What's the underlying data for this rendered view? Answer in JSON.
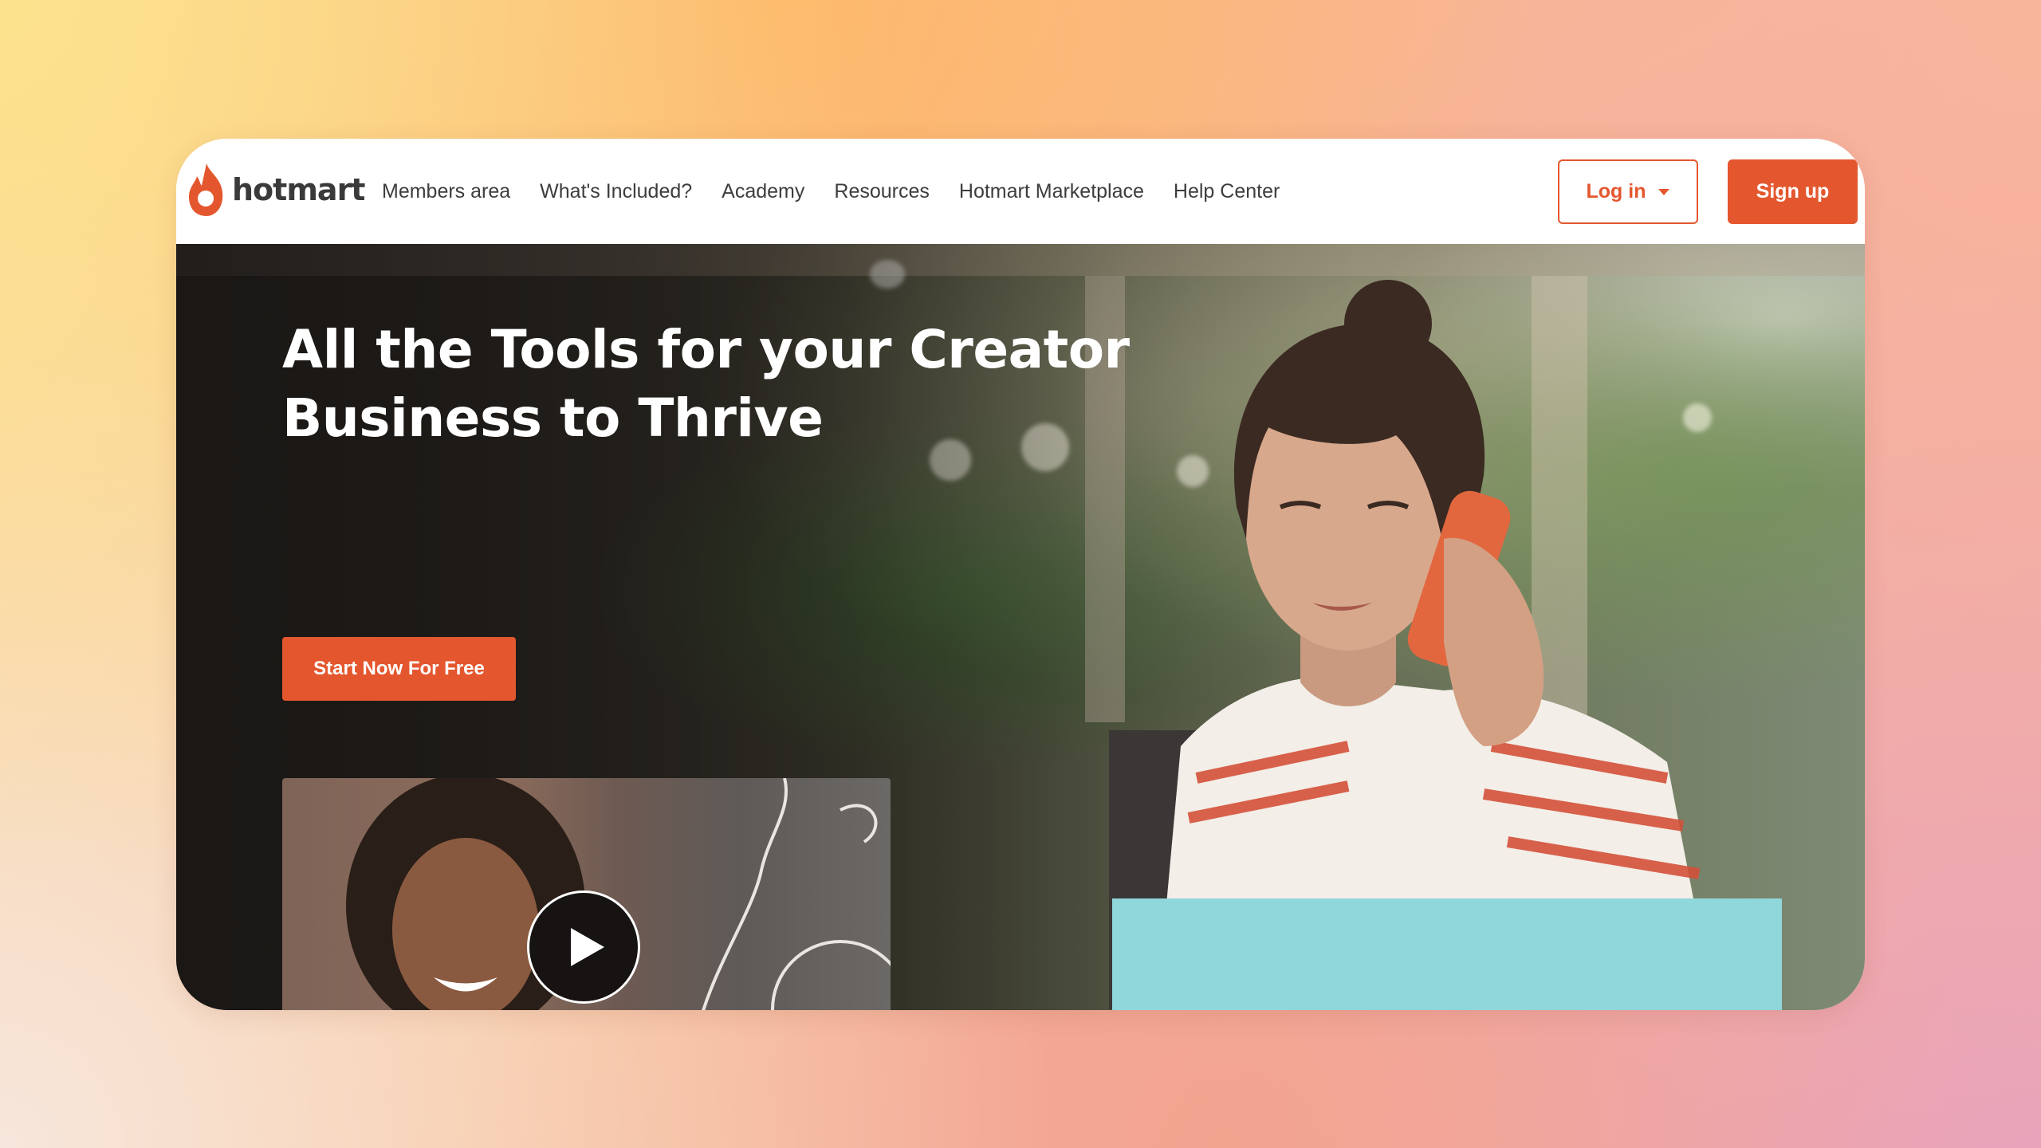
{
  "brand": {
    "name": "hotmart",
    "accent_color": "#e4572e",
    "logo_icon": "flame-icon"
  },
  "nav": {
    "items": [
      {
        "label": "Members area"
      },
      {
        "label": "What's Included?"
      },
      {
        "label": "Academy"
      },
      {
        "label": "Resources"
      },
      {
        "label": "Hotmart Marketplace"
      },
      {
        "label": "Help Center"
      }
    ],
    "login_label": "Log in",
    "login_icon": "caret-down-icon",
    "signup_label": "Sign up"
  },
  "hero": {
    "headline_line1": "All the Tools for your Creator",
    "headline_line2": "Business to Thrive",
    "cta_label": "Start Now For Free",
    "video_icon": "play-icon",
    "block_color": "#90d7dc"
  }
}
